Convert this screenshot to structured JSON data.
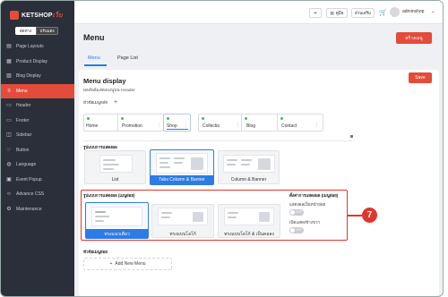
{
  "app": {
    "logo_prefix": "KETSHOP",
    "logo_suffix": "เว็บ",
    "mode_left": "อัตทาง",
    "mode_right": "ปรับแต่ง"
  },
  "sidebar": {
    "items": [
      {
        "label": "Page Layouts",
        "icon": "layout-icon"
      },
      {
        "label": "Product Display",
        "icon": "product-icon"
      },
      {
        "label": "Blog Display",
        "icon": "blog-icon"
      },
      {
        "label": "Menu",
        "icon": "menu-icon",
        "active": true
      },
      {
        "label": "Header",
        "icon": "header-icon"
      },
      {
        "label": "Footer",
        "icon": "footer-icon"
      },
      {
        "label": "Sidebar",
        "icon": "sidebar-icon"
      },
      {
        "label": "Button",
        "icon": "button-icon"
      },
      {
        "label": "Language",
        "icon": "globe-icon"
      },
      {
        "label": "Event Popup",
        "icon": "popup-icon"
      },
      {
        "label": "Advance CSS",
        "icon": "code-icon"
      },
      {
        "label": "Maintenance",
        "icon": "gear-icon"
      }
    ]
  },
  "topbar": {
    "btn1": "••",
    "btn2": "คู่มือ",
    "btn3": "ส่วนเสริม",
    "user": "adminshop"
  },
  "page": {
    "title": "Menu",
    "create_label": "สร้างเมนู",
    "tabs": [
      "Menu",
      "Page List"
    ]
  },
  "card": {
    "title": "Menu display",
    "subtitle": "ผลลัพธ์แสดงเมนูบน Header",
    "main_menu_label": "หัวข้อเมนูหลัก",
    "save_label": "Save",
    "menus": [
      "Home",
      "Promotion",
      "Shop",
      "Collectio",
      "Blog",
      "Contact"
    ],
    "format_label": "รูปแบบการแสดงผล",
    "formats": [
      "List",
      "Tabs Column & Banner",
      "Column & Banner"
    ],
    "sub_format_label": "รูปแบบการแสดงผล (เมนูย่อย)",
    "sub_formats": [
      "ทรงแนวเดียว",
      "ทรงแบบโลโก้",
      "ทรงแบบโลโก้ & เป็นคอลง"
    ],
    "sub_options_label": "ตั้งค่าการแสดงผล (เมนูย่อย)",
    "option1": "แสดงผลเป็นหน้าย่อย",
    "option2": "เปิดแสดงข้างขวา",
    "toggle_off": "OFF",
    "badge": "7",
    "sub_menu_label": "หัวข้อเมนูย่อย",
    "add_new": "Add New Menu"
  },
  "colors": {
    "accent": "#e34c3b",
    "primary": "#2d7be5",
    "highlight": "#e0362c"
  }
}
